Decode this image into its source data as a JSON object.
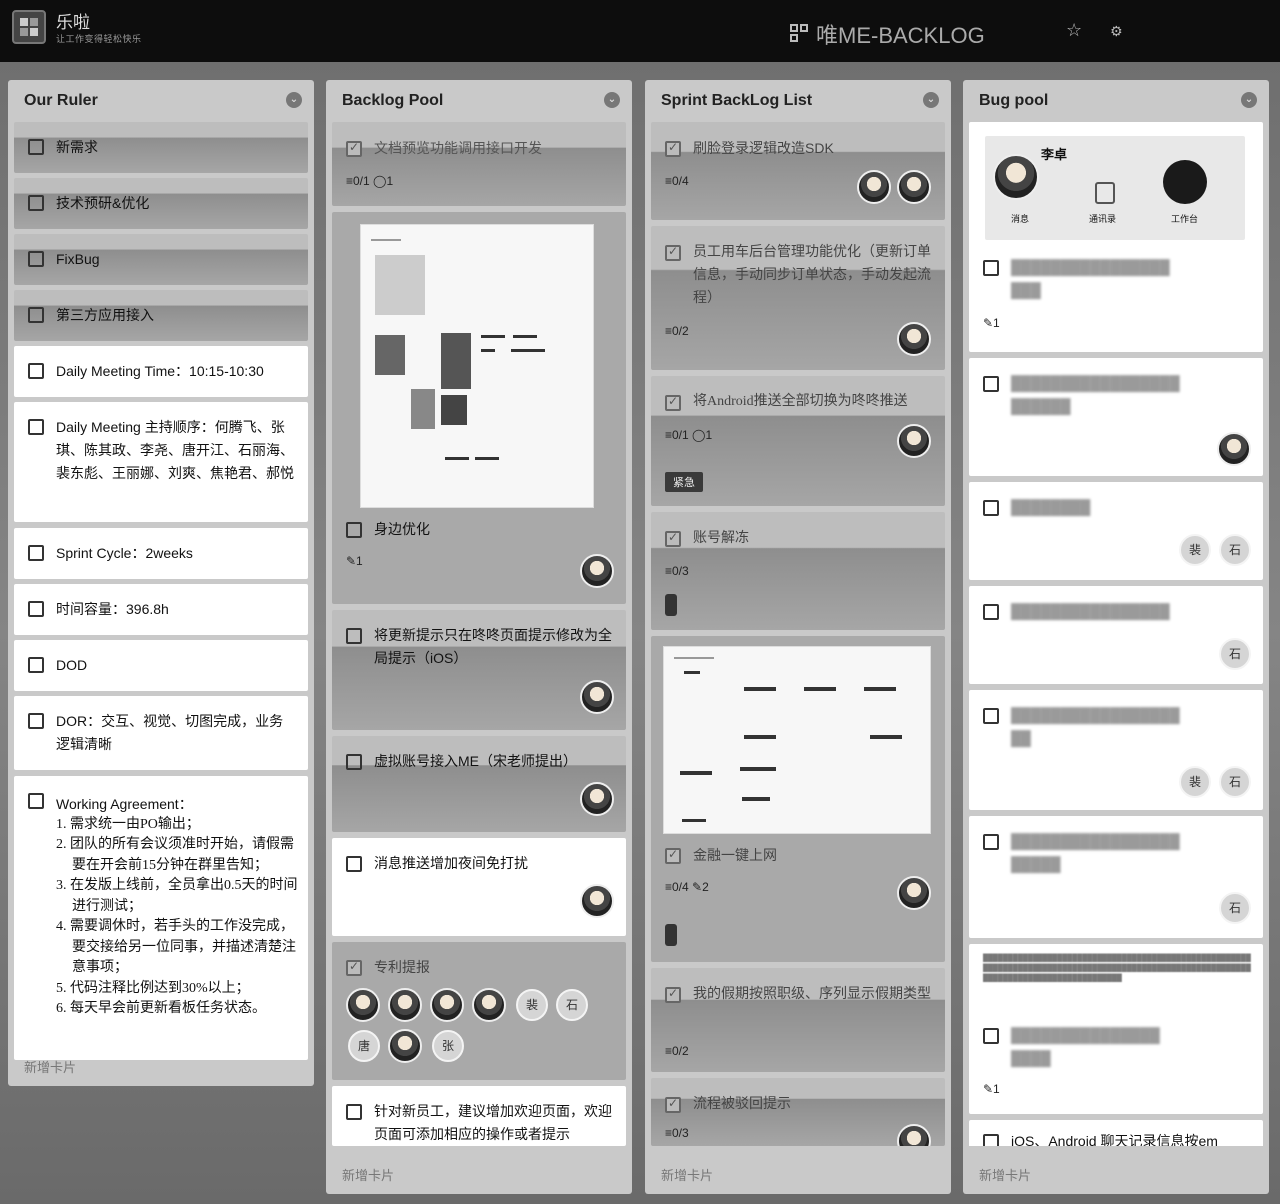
{
  "header": {
    "brand": "乐啦",
    "slogan": "让工作变得轻松快乐",
    "board_title": "唯ME-BACKLOG",
    "star_icon": "star-icon",
    "settings_icon": "gear-icon"
  },
  "columns": [
    {
      "title": "Our Ruler",
      "footer": "新增卡片",
      "cards": [
        {
          "text": "新需求"
        },
        {
          "text": "技术预研&优化"
        },
        {
          "text": "FixBug"
        },
        {
          "text": "第三方应用接入"
        },
        {
          "text": "Daily Meeting Time：10:15-10:30"
        },
        {
          "text": "Daily Meeting 主持顺序：何腾飞、张琪、陈其政、李尧、唐开江、石丽海、裴东彪、王丽娜、刘爽、焦艳君、郝悦"
        },
        {
          "text": "Sprint Cycle：2weeks"
        },
        {
          "text": "时间容量：396.8h"
        },
        {
          "text": "DOD"
        },
        {
          "text": "DOR：交互、视觉、切图完成，业务逻辑清晰"
        },
        {
          "text": "Working Agreement：",
          "items": [
            "1. 需求统一由PO输出；",
            "2. 团队的所有会议须准时开始，请假需要在开会前15分钟在群里告知；",
            "3. 在发版上线前，全员拿出0.5天的时间进行测试；",
            "4. 需要调休时，若手头的工作没完成，要交接给另一位同事，并描述清楚注意事项；",
            "5. 代码注释比例达到30%以上；",
            "6. 每天早会前更新看板任务状态。"
          ]
        }
      ]
    },
    {
      "title": "Backlog Pool",
      "footer": "新增卡片",
      "cards": [
        {
          "text": "文档预览功能调用接口开发",
          "meta": "≡0/1 ◯1"
        },
        {
          "text": "身边优化",
          "meta": "✎1"
        },
        {
          "text": "将更新提示只在咚咚页面提示修改为全局提示（iOS）"
        },
        {
          "text": "虚拟账号接入ME（宋老师提出）"
        },
        {
          "text": "消息推送增加夜间免打扰"
        },
        {
          "text": "专利提报",
          "badges": [
            "裴",
            "石",
            "唐",
            "张"
          ]
        },
        {
          "text": "针对新员工，建议增加欢迎页面，欢迎页面可添加相应的操作或者提示"
        }
      ]
    },
    {
      "title": "Sprint BackLog List",
      "footer": "新增卡片",
      "cards": [
        {
          "text": "刷脸登录逻辑改造SDK",
          "meta": "≡0/4"
        },
        {
          "text": "员工用车后台管理功能优化（更新订单信息，手动同步订单状态，手动发起流程）",
          "meta": "≡0/2"
        },
        {
          "text": "将Android推送全部切换为咚咚推送",
          "meta": "≡0/1 ◯1",
          "label": "紧急"
        },
        {
          "text": "账号解冻",
          "meta": "≡0/3"
        },
        {
          "text": "金融一键上网",
          "meta": "≡0/4 ✎2"
        },
        {
          "text": "我的假期按照职级、序列显示假期类型",
          "meta": "≡0/2"
        },
        {
          "text": "流程被驳回提示",
          "meta": "≡0/3"
        }
      ]
    },
    {
      "title": "Bug pool",
      "footer": "新增卡片",
      "cards": [
        {
          "preview_name": "李卓",
          "preview_tabs": [
            "消息",
            "通讯录",
            "工作台"
          ],
          "meta": "✎1",
          "badges": []
        },
        {
          "badges": []
        },
        {
          "badges": [
            "裴",
            "石"
          ]
        },
        {
          "badges": [
            "石"
          ]
        },
        {
          "badges": [
            "裴",
            "石"
          ]
        },
        {
          "badges": [
            "石"
          ]
        },
        {
          "meta": "✎1",
          "badges": []
        },
        {
          "text": "iOS、Android 聊天记录信息按em"
        }
      ]
    }
  ]
}
